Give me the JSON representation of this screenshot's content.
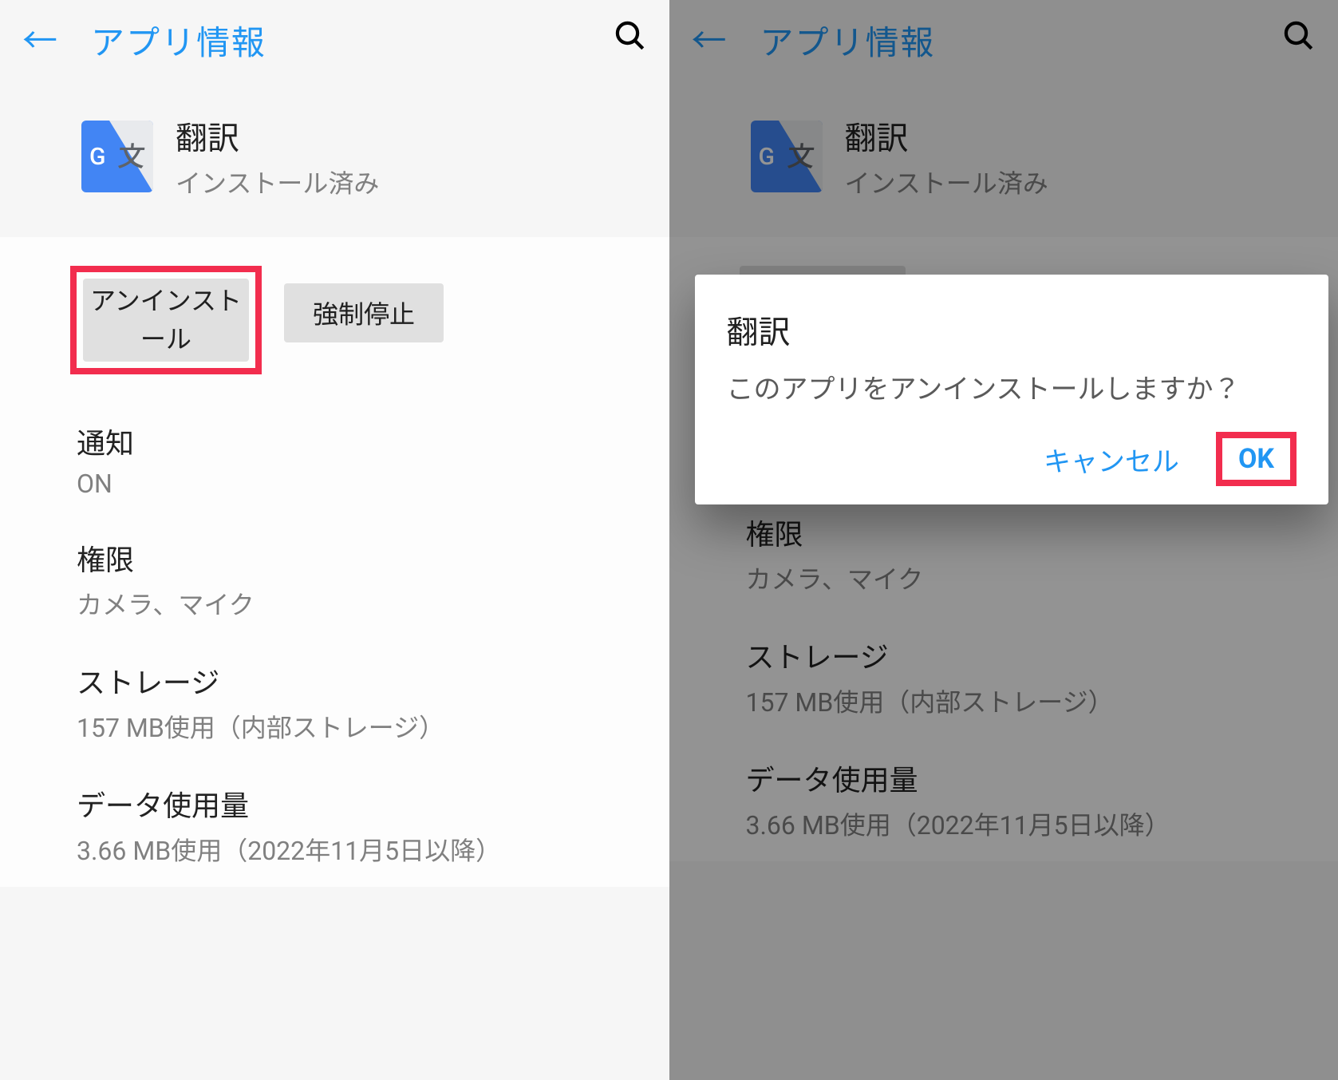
{
  "header": {
    "title": "アプリ情報"
  },
  "app": {
    "name": "翻訳",
    "status": "インストール済み",
    "icon_g": "G",
    "icon_cn": "文"
  },
  "buttons": {
    "uninstall": "アンインストール",
    "force_stop": "強制停止"
  },
  "rows": {
    "notify_label": "通知",
    "notify_value": "ON",
    "perm_label": "権限",
    "perm_value": "カメラ、マイク",
    "storage_label": "ストレージ",
    "storage_value": "157 MB使用（内部ストレージ）",
    "data_label": "データ使用量",
    "data_value": "3.66 MB使用（2022年11月5日以降）"
  },
  "dialog": {
    "title": "翻訳",
    "message": "このアプリをアンインストールしますか？",
    "cancel": "キャンセル",
    "ok": "OK"
  }
}
